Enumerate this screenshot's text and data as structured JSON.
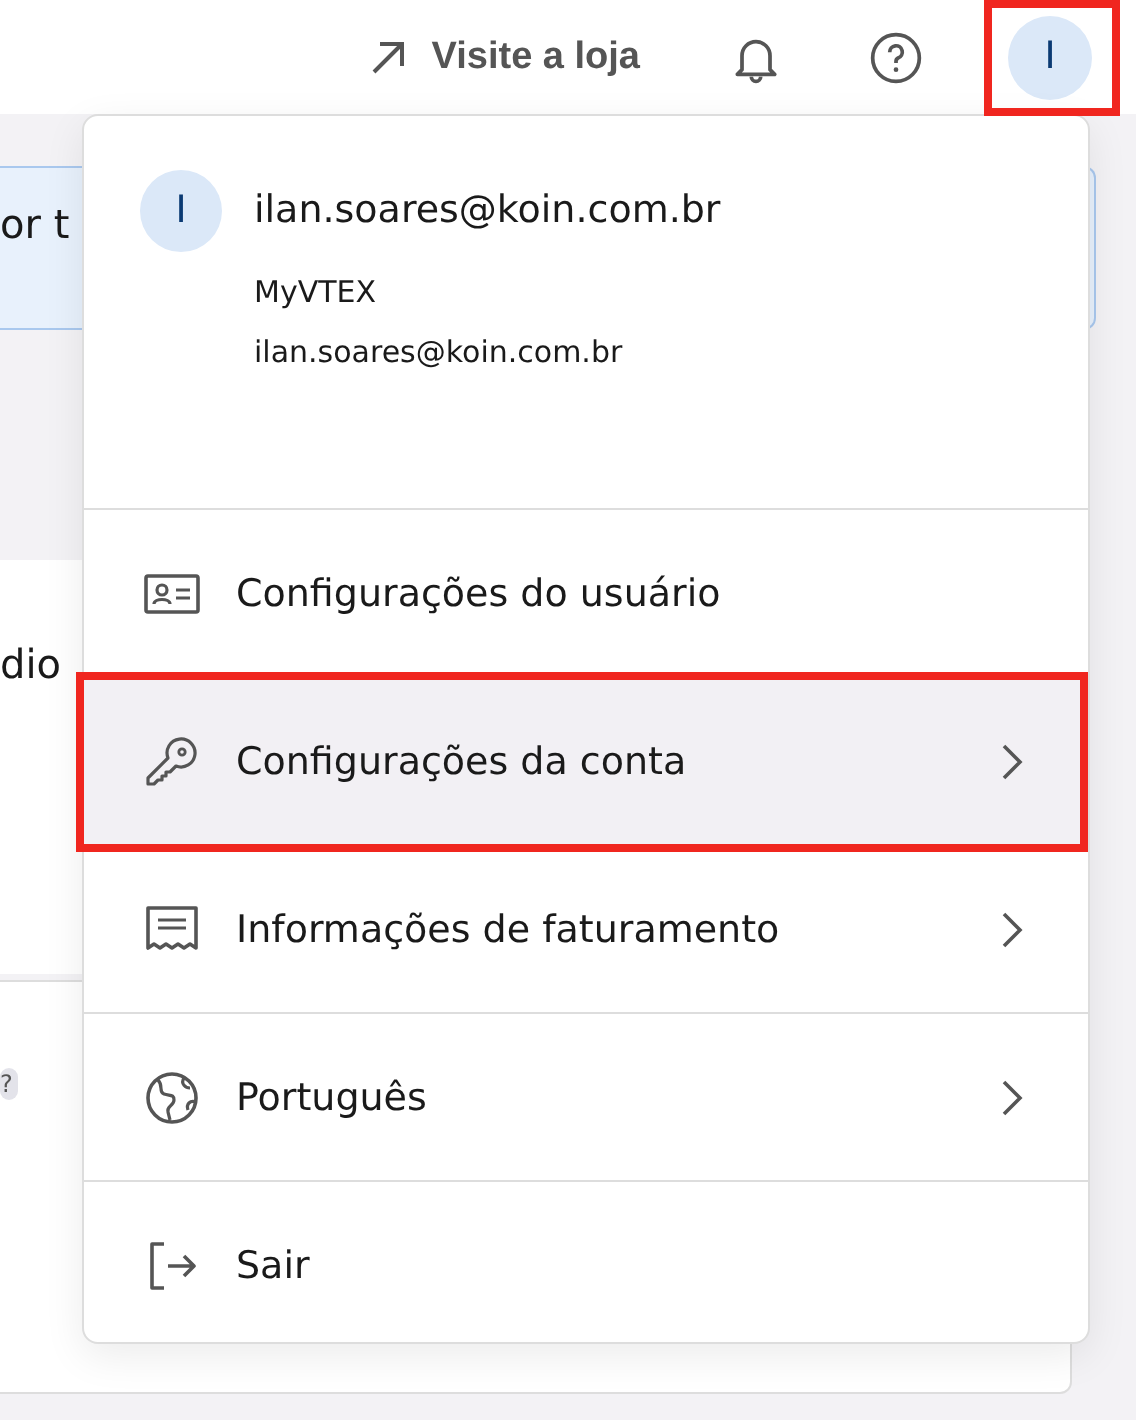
{
  "top_bar": {
    "store_link": "Visite a loja",
    "avatar_initial": "I"
  },
  "background": {
    "banner_text": "or t",
    "card_text": "dio",
    "badge_text": "?"
  },
  "user_menu": {
    "avatar_initial": "I",
    "email": "ilan.soares@koin.com.br",
    "account": "MyVTEX",
    "secondary_email": "ilan.soares@koin.com.br",
    "items": [
      {
        "label": "Configurações do usuário",
        "selected": false,
        "submenu": false
      },
      {
        "label": "Configurações da conta",
        "selected": true,
        "submenu": true
      },
      {
        "label": "Informações de faturamento",
        "selected": false,
        "submenu": true
      },
      {
        "label": "Português",
        "selected": false,
        "submenu": true
      },
      {
        "label": "Sair",
        "selected": false,
        "submenu": false
      }
    ]
  }
}
